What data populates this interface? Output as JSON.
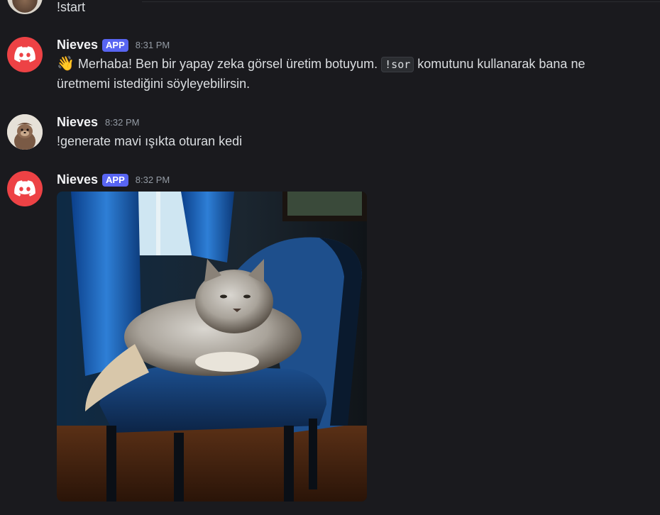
{
  "messages": [
    {
      "text": "!start"
    },
    {
      "username": "Nieves",
      "badge": "APP",
      "time": "8:31 PM",
      "emoji": "👋",
      "text_before": "Merhaba! Ben bir yapay zeka görsel üretim botuyum.",
      "code": "!sor",
      "text_after": "komutunu kullanarak bana ne üretmemi istediğini söyleyebilirsin."
    },
    {
      "username": "Nieves",
      "time": "8:32 PM",
      "text": "!generate mavi ışıkta oturan kedi"
    },
    {
      "username": "Nieves",
      "badge": "APP",
      "time": "8:32 PM"
    }
  ],
  "colors": {
    "background": "#1a1a1e",
    "discord_red": "#ed4245",
    "app_badge": "#5865f2"
  },
  "icons": {
    "bot_avatar": "discord-logo-icon",
    "user_avatar": "user-avatar"
  },
  "attachment": {
    "type": "generated-image",
    "subject": "cat-on-blue-chair"
  }
}
